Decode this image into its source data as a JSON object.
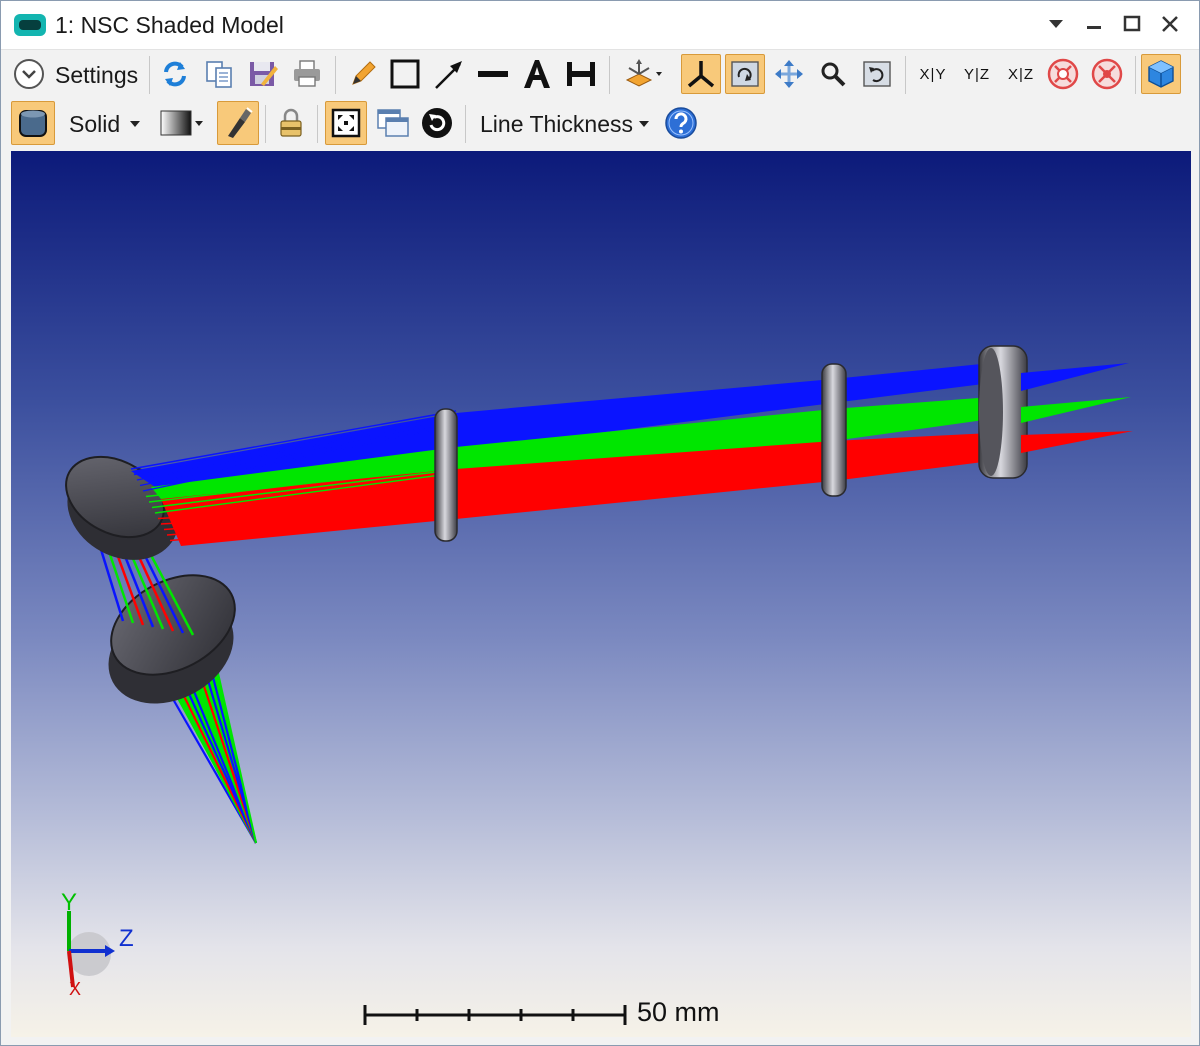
{
  "window": {
    "title": "1: NSC Shaded Model"
  },
  "toolbar1": {
    "settings_label": "Settings",
    "axis_views": [
      "X|Y",
      "Y|Z",
      "X|Z"
    ]
  },
  "toolbar2": {
    "render_mode": "Solid",
    "line_thickness_label": "Line Thickness"
  },
  "viewport": {
    "scale_bar_label": "50 mm",
    "axes": {
      "y": "Y",
      "z": "Z",
      "x": "X"
    }
  },
  "colors": {
    "accent_active": "#f8c97a",
    "ray_blue": "#0a14ff",
    "ray_green": "#00e600",
    "ray_red": "#ff0000"
  }
}
